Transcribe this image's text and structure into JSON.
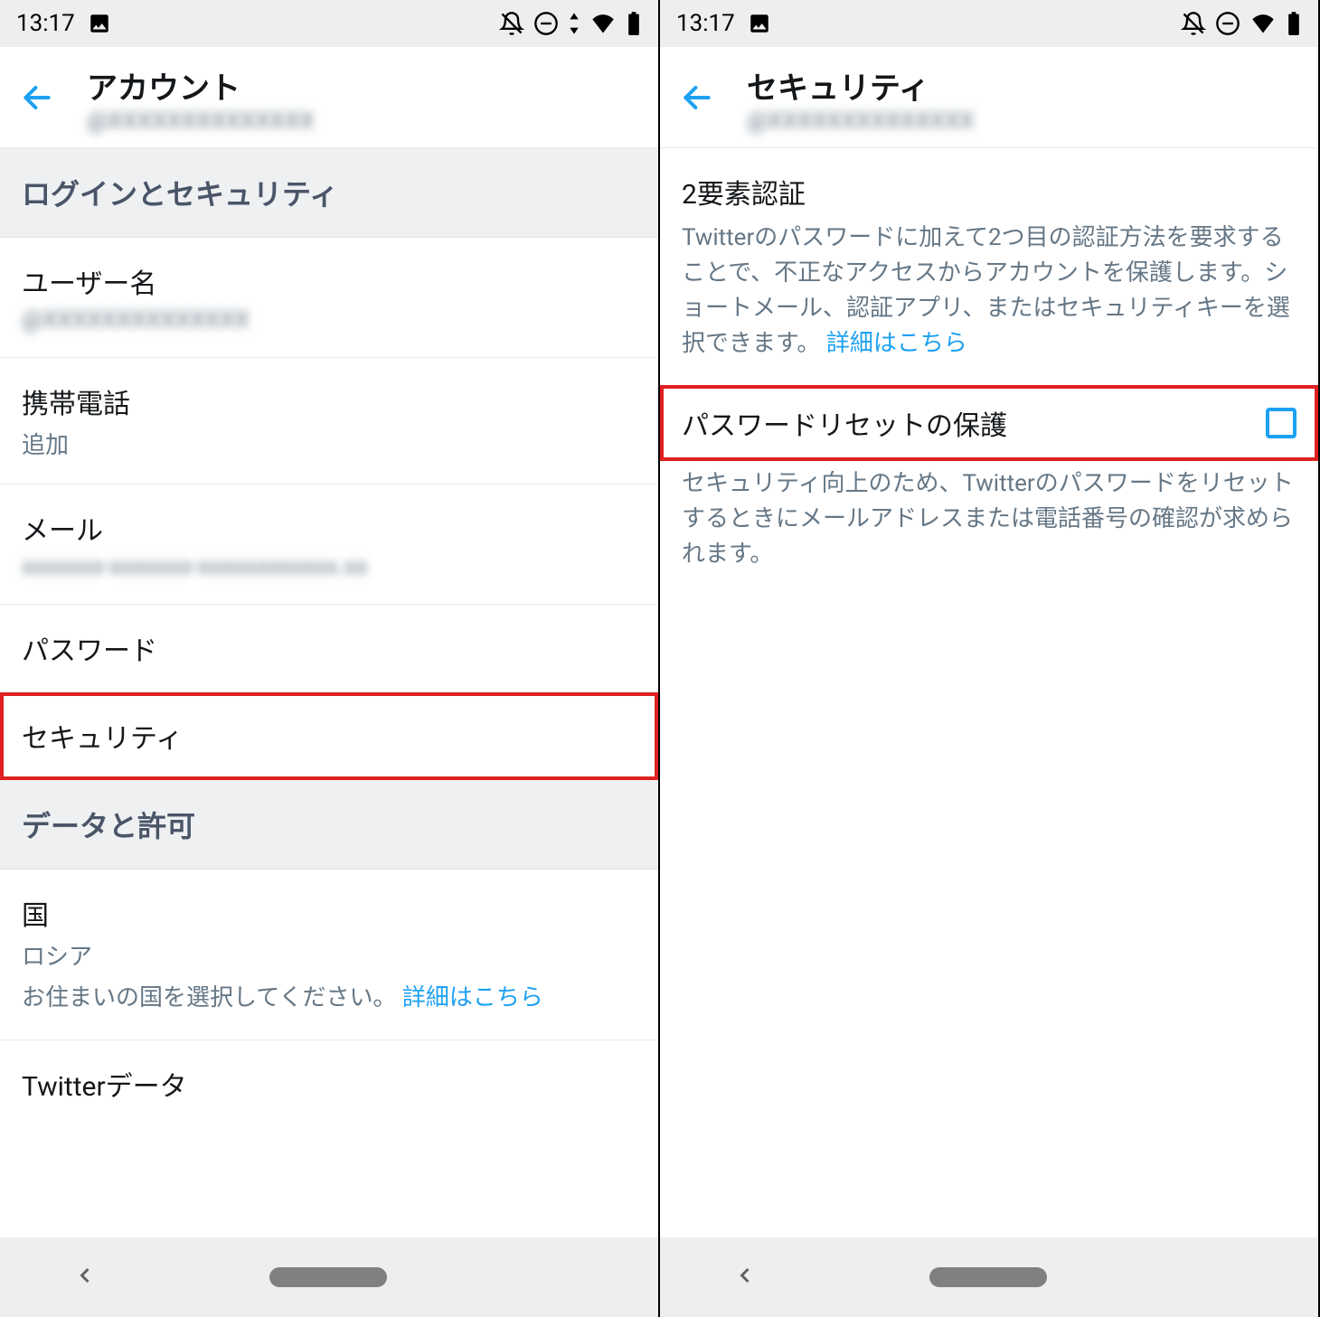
{
  "status": {
    "time": "13:17"
  },
  "left": {
    "header": {
      "title": "アカウント",
      "subtitle": "@XXXXXXXXXXXXXX"
    },
    "sections": {
      "login_security": {
        "header": "ログインとセキュリティ",
        "username": {
          "title": "ユーザー名",
          "value": "@XXXXXXXXXXXXXX"
        },
        "phone": {
          "title": "携帯電話",
          "value": "追加"
        },
        "email": {
          "title": "メール",
          "value": "xxxxxxx-xxxxxxx-xxxxxxxxxxxx.xx"
        },
        "password": {
          "title": "パスワード"
        },
        "security": {
          "title": "セキュリティ"
        }
      },
      "data_permissions": {
        "header": "データと許可",
        "country": {
          "title": "国",
          "value": "ロシア",
          "desc": "お住まいの国を選択してください。",
          "link": "詳細はこちら"
        },
        "twitter_data": {
          "title": "Twitterデータ"
        }
      }
    }
  },
  "right": {
    "header": {
      "title": "セキュリティ",
      "subtitle": "@XXXXXXXXXXXXXX"
    },
    "twofa": {
      "title": "2要素認証",
      "desc": "Twitterのパスワードに加えて2つ目の認証方法を要求することで、不正なアクセスからアカウントを保護します。ショートメール、認証アプリ、またはセキュリティキーを選択できます。",
      "link": "詳細はこちら"
    },
    "password_reset": {
      "title": "パスワードリセットの保護",
      "desc": "セキュリティ向上のため、Twitterのパスワードをリセットするときにメールアドレスまたは電話番号の確認が求められます。"
    }
  }
}
